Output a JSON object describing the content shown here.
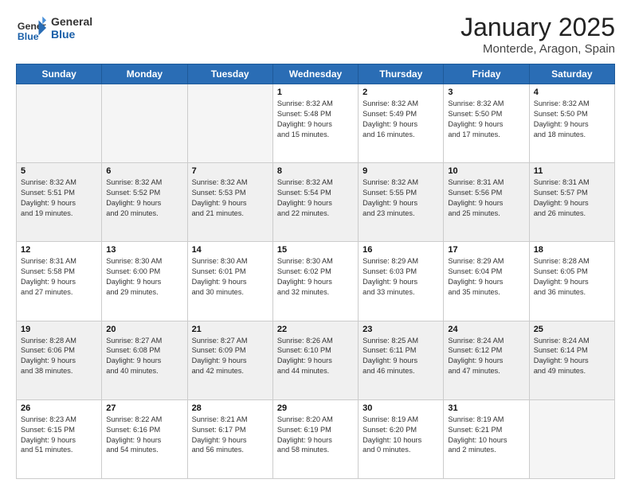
{
  "logo": {
    "general": "General",
    "blue": "Blue"
  },
  "header": {
    "month": "January 2025",
    "location": "Monterde, Aragon, Spain"
  },
  "weekdays": [
    "Sunday",
    "Monday",
    "Tuesday",
    "Wednesday",
    "Thursday",
    "Friday",
    "Saturday"
  ],
  "weeks": [
    [
      {
        "day": "",
        "info": ""
      },
      {
        "day": "",
        "info": ""
      },
      {
        "day": "",
        "info": ""
      },
      {
        "day": "1",
        "info": "Sunrise: 8:32 AM\nSunset: 5:48 PM\nDaylight: 9 hours\nand 15 minutes."
      },
      {
        "day": "2",
        "info": "Sunrise: 8:32 AM\nSunset: 5:49 PM\nDaylight: 9 hours\nand 16 minutes."
      },
      {
        "day": "3",
        "info": "Sunrise: 8:32 AM\nSunset: 5:50 PM\nDaylight: 9 hours\nand 17 minutes."
      },
      {
        "day": "4",
        "info": "Sunrise: 8:32 AM\nSunset: 5:50 PM\nDaylight: 9 hours\nand 18 minutes."
      }
    ],
    [
      {
        "day": "5",
        "info": "Sunrise: 8:32 AM\nSunset: 5:51 PM\nDaylight: 9 hours\nand 19 minutes."
      },
      {
        "day": "6",
        "info": "Sunrise: 8:32 AM\nSunset: 5:52 PM\nDaylight: 9 hours\nand 20 minutes."
      },
      {
        "day": "7",
        "info": "Sunrise: 8:32 AM\nSunset: 5:53 PM\nDaylight: 9 hours\nand 21 minutes."
      },
      {
        "day": "8",
        "info": "Sunrise: 8:32 AM\nSunset: 5:54 PM\nDaylight: 9 hours\nand 22 minutes."
      },
      {
        "day": "9",
        "info": "Sunrise: 8:32 AM\nSunset: 5:55 PM\nDaylight: 9 hours\nand 23 minutes."
      },
      {
        "day": "10",
        "info": "Sunrise: 8:31 AM\nSunset: 5:56 PM\nDaylight: 9 hours\nand 25 minutes."
      },
      {
        "day": "11",
        "info": "Sunrise: 8:31 AM\nSunset: 5:57 PM\nDaylight: 9 hours\nand 26 minutes."
      }
    ],
    [
      {
        "day": "12",
        "info": "Sunrise: 8:31 AM\nSunset: 5:58 PM\nDaylight: 9 hours\nand 27 minutes."
      },
      {
        "day": "13",
        "info": "Sunrise: 8:30 AM\nSunset: 6:00 PM\nDaylight: 9 hours\nand 29 minutes."
      },
      {
        "day": "14",
        "info": "Sunrise: 8:30 AM\nSunset: 6:01 PM\nDaylight: 9 hours\nand 30 minutes."
      },
      {
        "day": "15",
        "info": "Sunrise: 8:30 AM\nSunset: 6:02 PM\nDaylight: 9 hours\nand 32 minutes."
      },
      {
        "day": "16",
        "info": "Sunrise: 8:29 AM\nSunset: 6:03 PM\nDaylight: 9 hours\nand 33 minutes."
      },
      {
        "day": "17",
        "info": "Sunrise: 8:29 AM\nSunset: 6:04 PM\nDaylight: 9 hours\nand 35 minutes."
      },
      {
        "day": "18",
        "info": "Sunrise: 8:28 AM\nSunset: 6:05 PM\nDaylight: 9 hours\nand 36 minutes."
      }
    ],
    [
      {
        "day": "19",
        "info": "Sunrise: 8:28 AM\nSunset: 6:06 PM\nDaylight: 9 hours\nand 38 minutes."
      },
      {
        "day": "20",
        "info": "Sunrise: 8:27 AM\nSunset: 6:08 PM\nDaylight: 9 hours\nand 40 minutes."
      },
      {
        "day": "21",
        "info": "Sunrise: 8:27 AM\nSunset: 6:09 PM\nDaylight: 9 hours\nand 42 minutes."
      },
      {
        "day": "22",
        "info": "Sunrise: 8:26 AM\nSunset: 6:10 PM\nDaylight: 9 hours\nand 44 minutes."
      },
      {
        "day": "23",
        "info": "Sunrise: 8:25 AM\nSunset: 6:11 PM\nDaylight: 9 hours\nand 46 minutes."
      },
      {
        "day": "24",
        "info": "Sunrise: 8:24 AM\nSunset: 6:12 PM\nDaylight: 9 hours\nand 47 minutes."
      },
      {
        "day": "25",
        "info": "Sunrise: 8:24 AM\nSunset: 6:14 PM\nDaylight: 9 hours\nand 49 minutes."
      }
    ],
    [
      {
        "day": "26",
        "info": "Sunrise: 8:23 AM\nSunset: 6:15 PM\nDaylight: 9 hours\nand 51 minutes."
      },
      {
        "day": "27",
        "info": "Sunrise: 8:22 AM\nSunset: 6:16 PM\nDaylight: 9 hours\nand 54 minutes."
      },
      {
        "day": "28",
        "info": "Sunrise: 8:21 AM\nSunset: 6:17 PM\nDaylight: 9 hours\nand 56 minutes."
      },
      {
        "day": "29",
        "info": "Sunrise: 8:20 AM\nSunset: 6:19 PM\nDaylight: 9 hours\nand 58 minutes."
      },
      {
        "day": "30",
        "info": "Sunrise: 8:19 AM\nSunset: 6:20 PM\nDaylight: 10 hours\nand 0 minutes."
      },
      {
        "day": "31",
        "info": "Sunrise: 8:19 AM\nSunset: 6:21 PM\nDaylight: 10 hours\nand 2 minutes."
      },
      {
        "day": "",
        "info": ""
      }
    ]
  ]
}
